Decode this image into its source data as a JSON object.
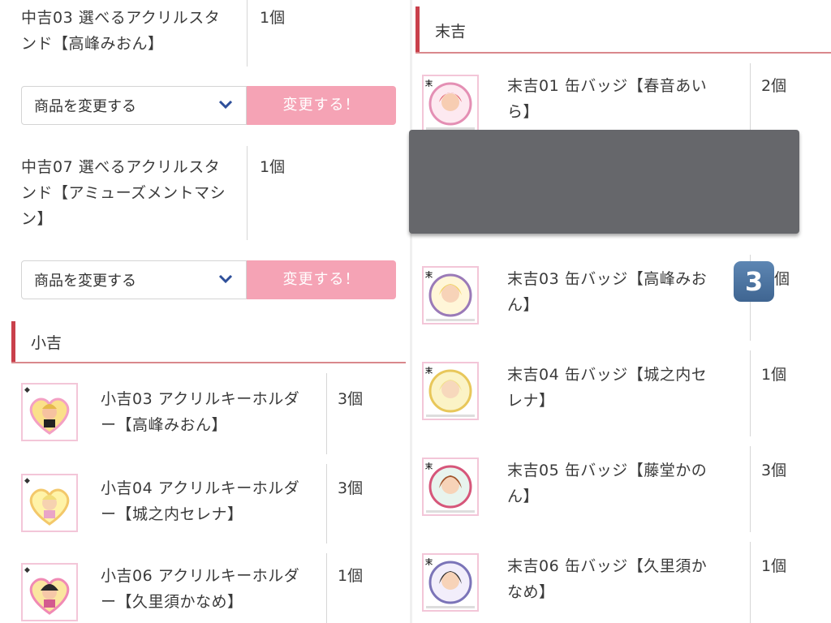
{
  "left": {
    "chukichi_items": [
      {
        "name_line1": "中吉03 選べるアクリルスタ",
        "name_line2": "ンド【高峰みおん】",
        "name_line3": "",
        "quantity": "1個"
      },
      {
        "name_line1": "中吉07 選べるアクリルスタ",
        "name_line2": "ンド【アミューズメントマシ",
        "name_line3": "ン】",
        "quantity": "1個"
      }
    ],
    "change_selects": [
      {
        "label": "商品を変更する",
        "button": "変更する！"
      },
      {
        "label": "商品を変更する",
        "button": "変更する！"
      }
    ],
    "shoukichi_heading": "小吉",
    "shoukichi_items": [
      {
        "name_line1": "小吉03 アクリルキーホルダ",
        "name_line2": "ー【高峰みおん】",
        "quantity": "3個",
        "icon": "heart-keychain-thumbnail"
      },
      {
        "name_line1": "小吉04 アクリルキーホルダ",
        "name_line2": "ー【城之内セレナ】",
        "quantity": "3個",
        "icon": "heart-keychain-thumbnail"
      },
      {
        "name_line1": "小吉06 アクリルキーホルダ",
        "name_line2": "ー【久里須かなめ】",
        "quantity": "1個",
        "icon": "heart-keychain-thumbnail"
      }
    ]
  },
  "right": {
    "suekichi_heading": "末吉",
    "thumb_corner_label": "末",
    "suekichi_items": [
      {
        "name_line1": "末吉01 缶バッジ【春音あい",
        "name_line2": "ら】",
        "quantity": "2個",
        "icon": "can-badge-thumbnail"
      },
      {
        "name_line1": "末吉03 缶バッジ【高峰みお",
        "name_line2": "ん】",
        "quantity": "個",
        "icon": "can-badge-thumbnail"
      },
      {
        "name_line1": "末吉04 缶バッジ【城之内セ",
        "name_line2": "レナ】",
        "quantity": "1個",
        "icon": "can-badge-thumbnail"
      },
      {
        "name_line1": "末吉05 缶バッジ【藤堂かの",
        "name_line2": "ん】",
        "quantity": "3個",
        "icon": "can-badge-thumbnail"
      },
      {
        "name_line1": "末吉06 缶バッジ【久里須か",
        "name_line2": "なめ】",
        "quantity": "1個",
        "icon": "can-badge-thumbnail"
      }
    ]
  },
  "overlay": {
    "badge_text": "3"
  },
  "colors": {
    "accent_red": "#c9404b",
    "button_pink": "#f5a3b5",
    "chevron_blue": "#2e4f9a",
    "occluder_gray": "#66676b",
    "badge_blue": "#4a72a0"
  }
}
